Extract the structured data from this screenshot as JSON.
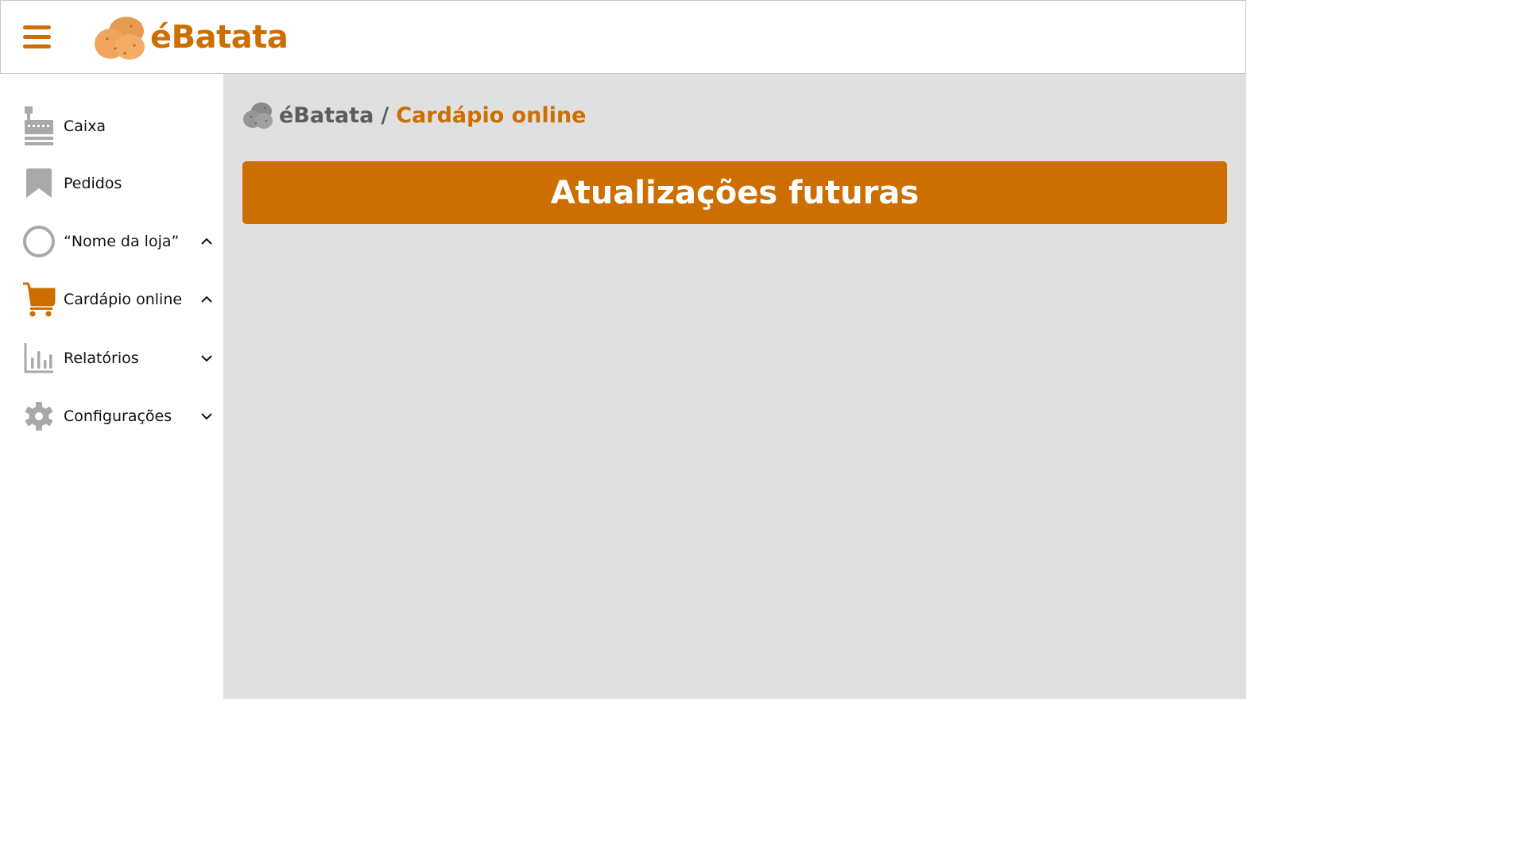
{
  "brand": {
    "name": "éBatata",
    "accent_color": "#cc6e00",
    "icon": "potato-logo-icon"
  },
  "header": {
    "menu_icon": "hamburger-menu-icon"
  },
  "sidebar": {
    "items": [
      {
        "label": "Caixa",
        "icon": "cash-register-icon",
        "chevron": null,
        "active": false
      },
      {
        "label": "Pedidos",
        "icon": "bookmark-icon",
        "chevron": null,
        "active": false
      },
      {
        "label": "“Nome da loja”",
        "icon": "store-avatar-circle-icon",
        "chevron": "up",
        "active": false
      },
      {
        "label": "Cardápio online",
        "icon": "shopping-cart-icon",
        "chevron": "up",
        "active": true
      },
      {
        "label": "Relatórios",
        "icon": "bar-chart-icon",
        "chevron": "down",
        "active": false
      },
      {
        "label": "Configurações",
        "icon": "gear-icon",
        "chevron": "down",
        "active": false
      }
    ]
  },
  "breadcrumb": {
    "root": "éBatata",
    "separator": "/",
    "current": "Cardápio online"
  },
  "banner": {
    "text": "Atualizações futuras",
    "color": "#cc6e00"
  },
  "colors": {
    "main_background": "#e0e0e0",
    "icon_gray": "#a9a9a9"
  }
}
